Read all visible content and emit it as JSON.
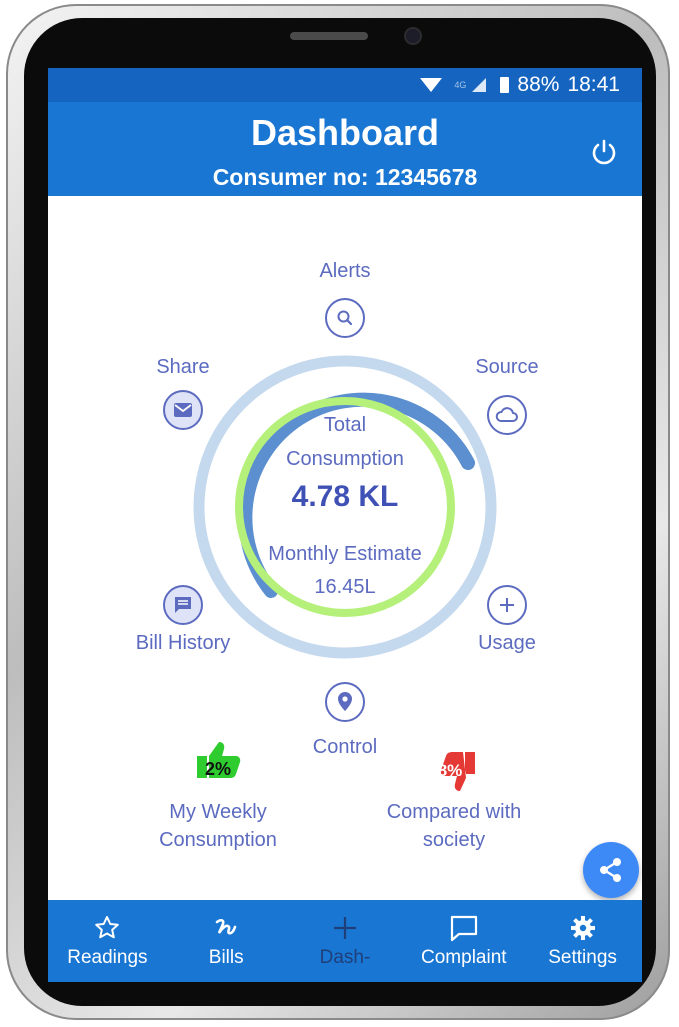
{
  "status_bar": {
    "network": "4G",
    "battery": "88%",
    "time": "18:41"
  },
  "header": {
    "title": "Dashboard",
    "subtitle": "Consumer no: 12345678"
  },
  "radial_menu": {
    "alerts": "Alerts",
    "source": "Source",
    "share": "Share",
    "bill_history": "Bill History",
    "usage": "Usage",
    "control": "Control"
  },
  "gauge": {
    "title_line1": "Total",
    "title_line2": "Consumption",
    "value": "4.78 KL",
    "estimate_label": "Monthly Estimate",
    "estimate_value": "16.45L"
  },
  "stats": {
    "weekly": {
      "badge": "2%",
      "line1": "My Weekly",
      "line2": "Consumption"
    },
    "society": {
      "badge": "8%",
      "line1": "Compared with",
      "line2": "society"
    }
  },
  "bottom_nav": [
    {
      "label": "Readings",
      "icon": "star-icon"
    },
    {
      "label": "Bills",
      "icon": "bills-icon"
    },
    {
      "label": "Dash-",
      "icon": "plus-icon"
    },
    {
      "label": "Complaint",
      "icon": "chat-icon"
    },
    {
      "label": "Settings",
      "icon": "gear-icon"
    }
  ],
  "colors": {
    "primary": "#1976d2",
    "status_bar": "#1565c0",
    "accent_text": "#5c6bc0",
    "ring_outer": "#c5d9ee",
    "ring_blue": "#5b8fd0",
    "ring_green": "#b5f07a",
    "fab": "#3d8af7",
    "thumb_up": "#2ecc2e",
    "thumb_down": "#e53935"
  }
}
